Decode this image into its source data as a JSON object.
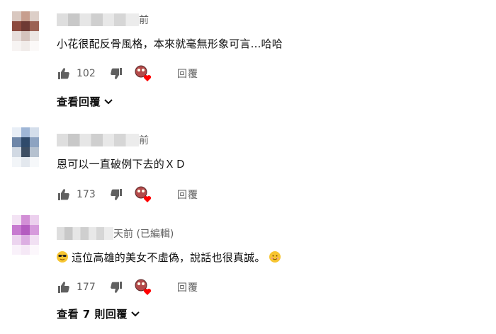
{
  "comments": [
    {
      "time_suffix": "前",
      "text": "小花很配反骨風格，本來就毫無形象可言...哈哈",
      "likes": "102",
      "reply_label": "回覆",
      "view_replies": "查看回覆"
    },
    {
      "time_suffix": "前",
      "text": "恩可以一直破例下去的ＸＤ",
      "likes": "173",
      "reply_label": "回覆"
    },
    {
      "time_suffix": "天前 (已編輯)",
      "text_before_emoji": "這位高雄的美女不虛偽，說話也很真誠。",
      "likes": "177",
      "reply_label": "回覆",
      "view_replies": "查看 7 則回覆"
    }
  ],
  "icons": {
    "like": "thumbs-up-icon",
    "dislike": "thumbs-down-icon",
    "creator_heart": "creator-heart-icon",
    "expand": "chevron-down-icon"
  },
  "colors": {
    "heart": "#ff0000",
    "secondary_text": "#606060",
    "icon": "#606060"
  }
}
